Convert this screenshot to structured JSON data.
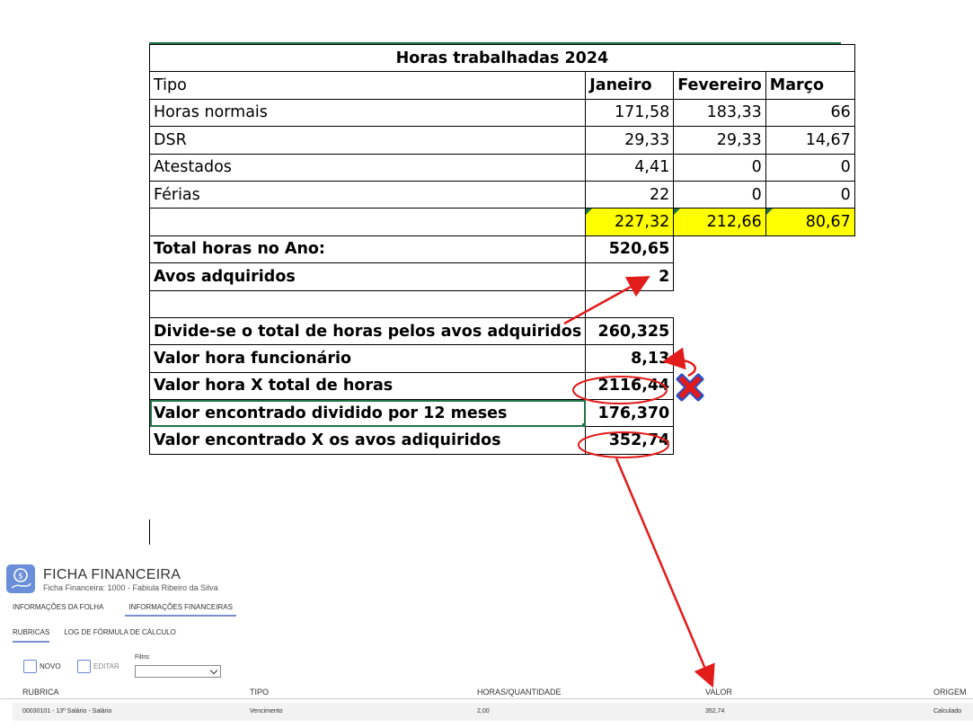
{
  "sheet": {
    "title": "Horas trabalhadas 2024",
    "headers": [
      "Tipo",
      "Janeiro",
      "Fevereiro",
      "Março"
    ],
    "rows": [
      {
        "label": "Horas normais",
        "jan": "171,58",
        "fev": "183,33",
        "mar": "66"
      },
      {
        "label": "DSR",
        "jan": "29,33",
        "fev": "29,33",
        "mar": "14,67"
      },
      {
        "label": "Atestados",
        "jan": "4,41",
        "fev": "0",
        "mar": "0"
      },
      {
        "label": "Férias",
        "jan": "22",
        "fev": "0",
        "mar": "0"
      }
    ],
    "totals": {
      "jan": "227,32",
      "fev": "212,66",
      "mar": "80,67"
    },
    "total_ano_label": "Total horas no Ano:",
    "total_ano_value": "520,65",
    "avos_label": "Avos adquiridos",
    "avos_value": "2",
    "calc": [
      {
        "label": "Divide-se o total de horas pelos avos adquiridos",
        "value": "260,325"
      },
      {
        "label": "Valor hora funcionário",
        "value": "8,13"
      },
      {
        "label": "Valor hora X total de horas",
        "value": "2116,44"
      },
      {
        "label": "Valor encontrado dividido por 12 meses",
        "value": "176,370"
      },
      {
        "label": "Valor encontrado X os avos adiquiridos",
        "value": "352,74"
      }
    ],
    "colors": {
      "highlight": "#ffff00",
      "annotation": "#e21b1b",
      "cross": "#2b4fc7",
      "excel_green": "#217346"
    }
  },
  "app": {
    "title": "FICHA FINANCEIRA",
    "subtitle": "Ficha Financeira: 1000 - Fabiula Ribeiro da Silva",
    "tabs": [
      "INFORMAÇÕES DA FOLHA",
      "INFORMAÇÕES FINANCEIRAS"
    ],
    "subtabs": [
      "RUBRICAS",
      "LOG DE FÓRMULA DE CÁLCULO"
    ],
    "new_label": "NOVO",
    "edit_label": "EDITAR",
    "filter_label": "Filtro:",
    "columns": [
      "RUBRICA",
      "TIPO",
      "HORAS/QUANTIDADE",
      "VALOR",
      "ORIGEM"
    ],
    "row": {
      "rubrica": "00030101 - 13º Salário - Salário",
      "tipo": "Vencimento",
      "horas": "2,00",
      "valor": "352,74",
      "origem": "Calculado"
    }
  }
}
